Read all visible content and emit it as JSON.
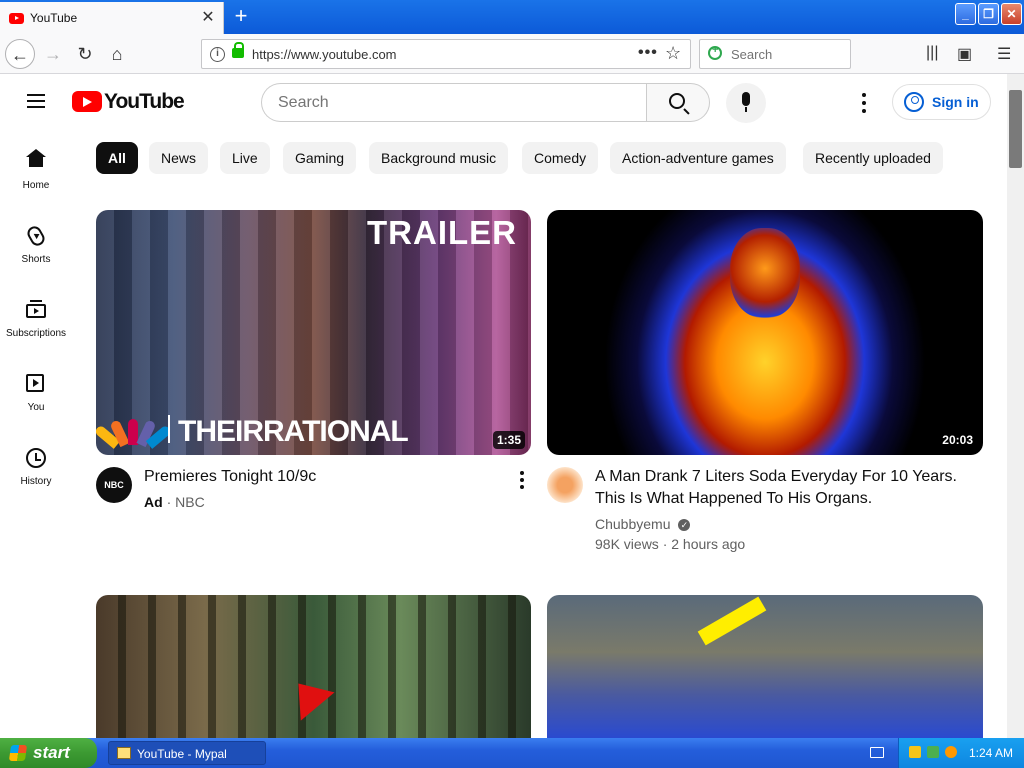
{
  "browser": {
    "tab_title": "YouTube",
    "url": "https://www.youtube.com",
    "search_placeholder": "Search",
    "url_more": "•••",
    "star": "☆"
  },
  "youtube": {
    "wordmark": "YouTube",
    "search_placeholder": "Search",
    "sign_in": "Sign in",
    "sidebar": [
      {
        "label": "Home",
        "icon": "home-icon"
      },
      {
        "label": "Shorts",
        "icon": "shorts-icon"
      },
      {
        "label": "Subscriptions",
        "icon": "subscriptions-icon"
      },
      {
        "label": "You",
        "icon": "you-icon"
      },
      {
        "label": "History",
        "icon": "history-icon"
      }
    ],
    "chips": [
      "All",
      "News",
      "Live",
      "Gaming",
      "Background music",
      "Comedy",
      "Action-adventure games",
      "Recently uploaded"
    ],
    "videos": [
      {
        "title": "Premieres Tonight 10/9c",
        "ad_label": "Ad",
        "separator": "·",
        "channel": "NBC",
        "duration": "1:35",
        "thumb_text_top": "TRAILER",
        "thumb_text_bottom": "THEIRRATIONAL",
        "avatar_text": "NBC"
      },
      {
        "title": "A Man Drank 7 Liters Soda Everyday For 10 Years. This Is What Happened To His Organs.",
        "channel": "Chubbyemu",
        "views": "98K views · 2 hours ago",
        "duration": "20:03"
      }
    ]
  },
  "taskbar": {
    "start": "start",
    "task_button": "YouTube - Mypal",
    "clock": "1:24 AM"
  }
}
